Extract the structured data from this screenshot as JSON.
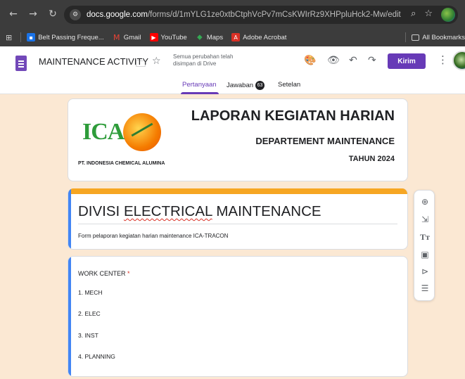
{
  "browser": {
    "url_domain": "docs.google.com",
    "url_path": "/forms/d/1mYLG1ze0xtbCtphVcPv7mCsKWIrRz9XHPpluHck2-Mw/edit",
    "bookmarks": [
      {
        "label": "Belt Passing Freque...",
        "color": "#1a73e8"
      },
      {
        "label": "Gmail",
        "color": "#ea4335"
      },
      {
        "label": "YouTube",
        "color": "#ff0000"
      },
      {
        "label": "Maps",
        "color": "#34a853"
      },
      {
        "label": "Adobe Acrobat",
        "color": "#d93025"
      }
    ],
    "all_bookmarks": "All Bookmarks"
  },
  "header": {
    "doc_title": "MAINTENANCE ACTIVITY",
    "save_status": "Semua perubahan telah disimpan di Drive",
    "send_label": "Kirim"
  },
  "tabs": {
    "questions": "Pertanyaan",
    "responses": "Jawaban",
    "responses_count": "63",
    "settings": "Setelan"
  },
  "banner": {
    "logo_text": "ICA",
    "company": "PT. INDONESIA CHEMICAL ALUMINA",
    "title": "LAPORAN KEGIATAN HARIAN",
    "subtitle": "DEPARTEMENT MAINTENANCE",
    "year": "TAHUN 2024"
  },
  "form": {
    "title_pre": "DIVISI ",
    "title_spell": "ELECTRICAL",
    "title_post": " MAINTENANCE",
    "description": "Form pelaporan kegiatan harian maintenance ICA-TRACON"
  },
  "question": {
    "label": "WORK CENTER",
    "required_mark": "*",
    "options": [
      "1. MECH",
      "2. ELEC",
      "3. INST",
      "4. PLANNING"
    ]
  },
  "colors": {
    "accent": "#673ab7",
    "theme_band": "#f6a623",
    "background": "#fbe8d3"
  }
}
